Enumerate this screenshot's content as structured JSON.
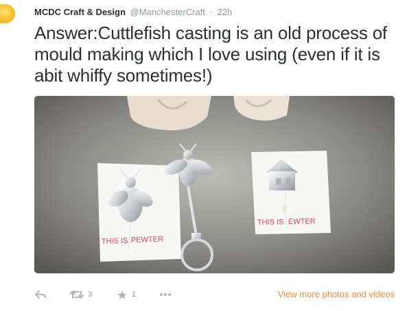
{
  "author": {
    "display_name": "MCDC Craft & Design",
    "screen_name": "@ManchesterCraft",
    "separator": "·",
    "time": "22h"
  },
  "tweet": {
    "text": "Answer:Cuttlefish casting is an old process of mould making which I love using (even if it is abit whiffy sometimes!)"
  },
  "media": {
    "card_left_text_a": "THIS IS",
    "card_left_text_b": "PEWTER",
    "card_right_text_a": "THIS IS",
    "card_right_text_b": "EWTER"
  },
  "actions": {
    "reply_icon": "reply-icon",
    "retweet_icon": "retweet-icon",
    "retweet_count": "3",
    "favorite_icon": "star-icon",
    "favorite_count": "1",
    "more_icon": "more-icon",
    "view_more_label": "View more photos and videos"
  },
  "colors": {
    "link": "#e8903c",
    "muted": "#8899a6",
    "text": "#292f33"
  }
}
